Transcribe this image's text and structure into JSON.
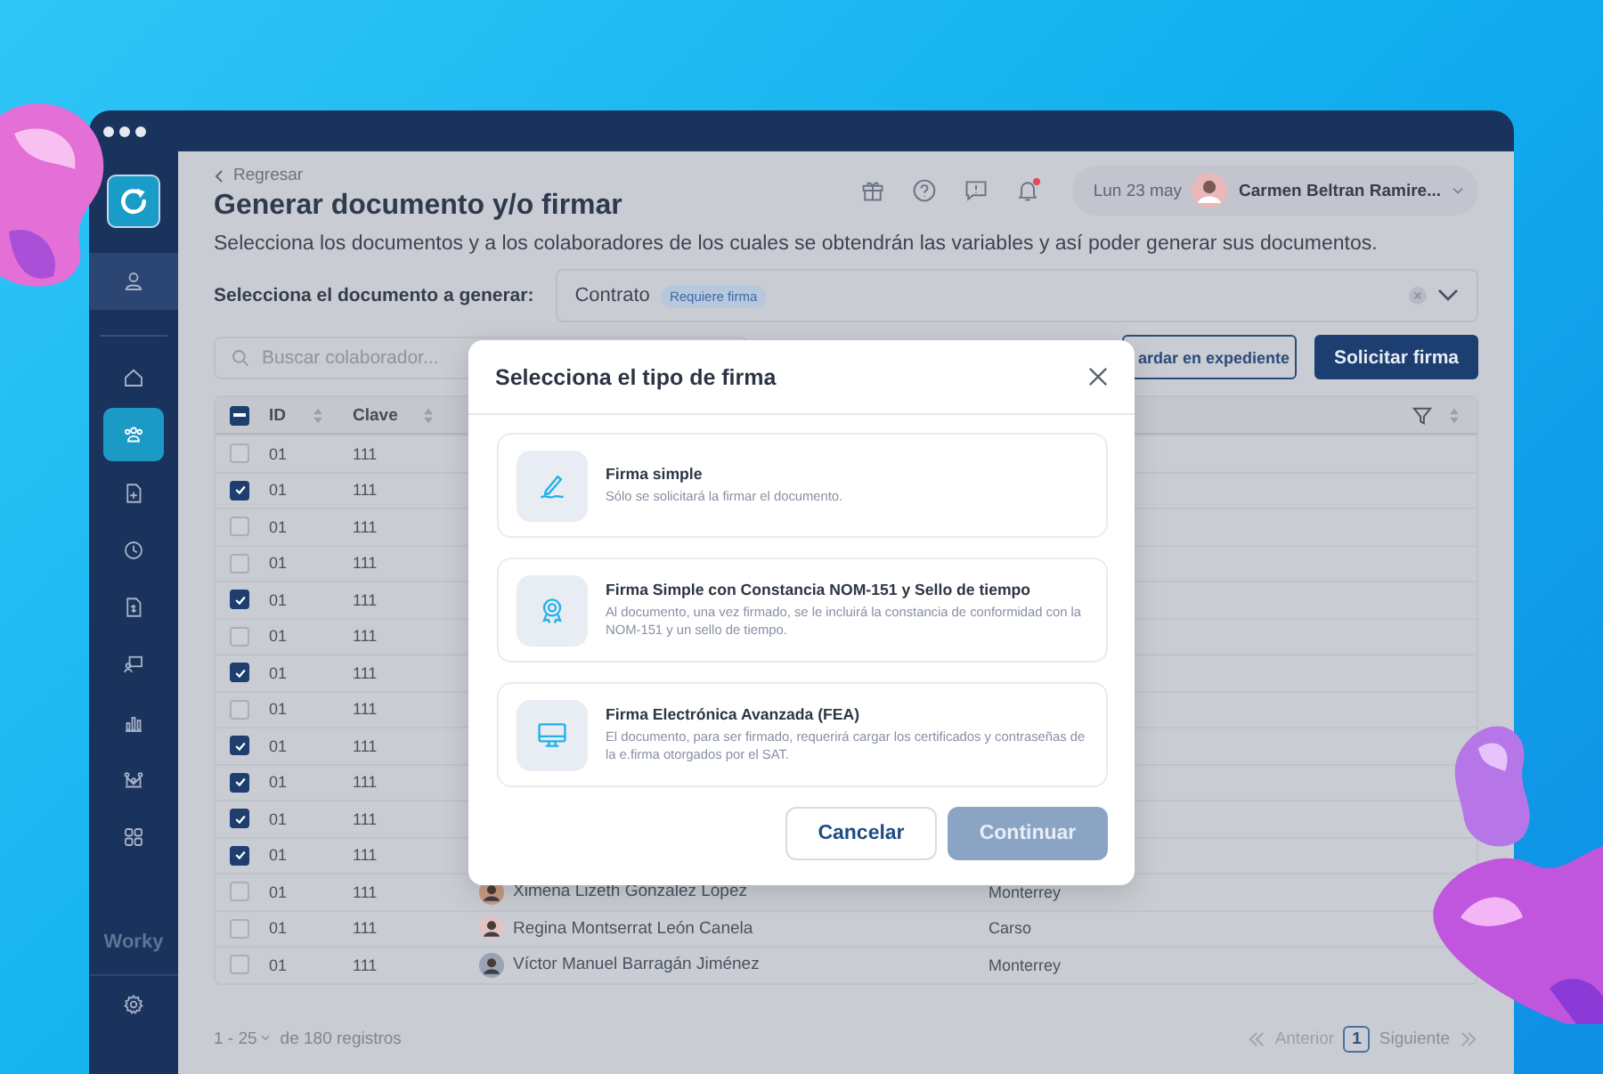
{
  "sidebar": {
    "items": [
      {
        "kind": "home",
        "selected": false
      },
      {
        "kind": "people",
        "selected": true
      },
      {
        "kind": "document",
        "selected": false
      },
      {
        "kind": "clock",
        "selected": false
      },
      {
        "kind": "invoice",
        "selected": false
      },
      {
        "kind": "presentation",
        "selected": false
      },
      {
        "kind": "chart",
        "selected": false
      },
      {
        "kind": "network",
        "selected": false
      },
      {
        "kind": "grid",
        "selected": false
      }
    ],
    "brand": "Worky"
  },
  "header": {
    "back": "Regresar",
    "title": "Generar documento y/o firmar",
    "date": "Lun 23 may",
    "user": "Carmen Beltran Ramire...",
    "notification": true
  },
  "description": "Selecciona los documentos y a los colaboradores de los cuales se obtendrán las variables y así poder generar sus documentos.",
  "document_select": {
    "label": "Selecciona el documento a generar:",
    "value": "Contrato",
    "tag": "Requiere firma"
  },
  "search": {
    "placeholder": "Buscar colaborador..."
  },
  "buttons": [
    {
      "label": "ardar en expediente",
      "kind": "outline"
    },
    {
      "label": "Solicitar firma",
      "kind": "primary"
    }
  ],
  "table": {
    "select_all_indeterminate": true,
    "columns": [
      "ID",
      "Clave"
    ],
    "rows": [
      {
        "id": "01",
        "clave": "111",
        "checked": false
      },
      {
        "id": "01",
        "clave": "111",
        "checked": true
      },
      {
        "id": "01",
        "clave": "111",
        "checked": false
      },
      {
        "id": "01",
        "clave": "111",
        "checked": false
      },
      {
        "id": "01",
        "clave": "111",
        "checked": true
      },
      {
        "id": "01",
        "clave": "111",
        "checked": false
      },
      {
        "id": "01",
        "clave": "111",
        "checked": true
      },
      {
        "id": "01",
        "clave": "111",
        "checked": false
      },
      {
        "id": "01",
        "clave": "111",
        "checked": true
      },
      {
        "id": "01",
        "clave": "111",
        "checked": true
      },
      {
        "id": "01",
        "clave": "111",
        "checked": true
      },
      {
        "id": "01",
        "clave": "111",
        "checked": true
      },
      {
        "id": "01",
        "clave": "111",
        "checked": false,
        "name": "Ximena Lizeth Gónzalez López",
        "city": "Monterrey"
      },
      {
        "id": "01",
        "clave": "111",
        "checked": false,
        "name": "Regina Montserrat León Canela",
        "city": "Carso"
      },
      {
        "id": "01",
        "clave": "111",
        "checked": false,
        "name": "Víctor Manuel Barragán Jiménez",
        "city": "Monterrey"
      }
    ]
  },
  "footer": {
    "range": "1 - 25",
    "total": "de 180 registros",
    "previous": "Anterior",
    "page": "1",
    "next": "Siguiente",
    "previous_disabled": true
  },
  "dialog": {
    "title": "Selecciona el tipo de firma",
    "options": [
      {
        "kind": "pen",
        "title": "Firma simple",
        "text": "Sólo se solicitará la firmar el documento."
      },
      {
        "kind": "badge",
        "title": "Firma Simple con Constancia NOM-151 y Sello de tiempo",
        "text": "Al documento, una vez firmado, se le incluirá la constancia de conformidad con la NOM-151 y un sello de tiempo."
      },
      {
        "kind": "monitor",
        "title": "Firma Electrónica Avanzada (FEA)",
        "text": "El documento, para ser firmado, requerirá cargar los certificados y contraseñas de la e.firma otorgados por el SAT."
      }
    ],
    "cancel": "Cancelar",
    "confirm": {
      "label": "Continuar",
      "disabled": true
    }
  }
}
